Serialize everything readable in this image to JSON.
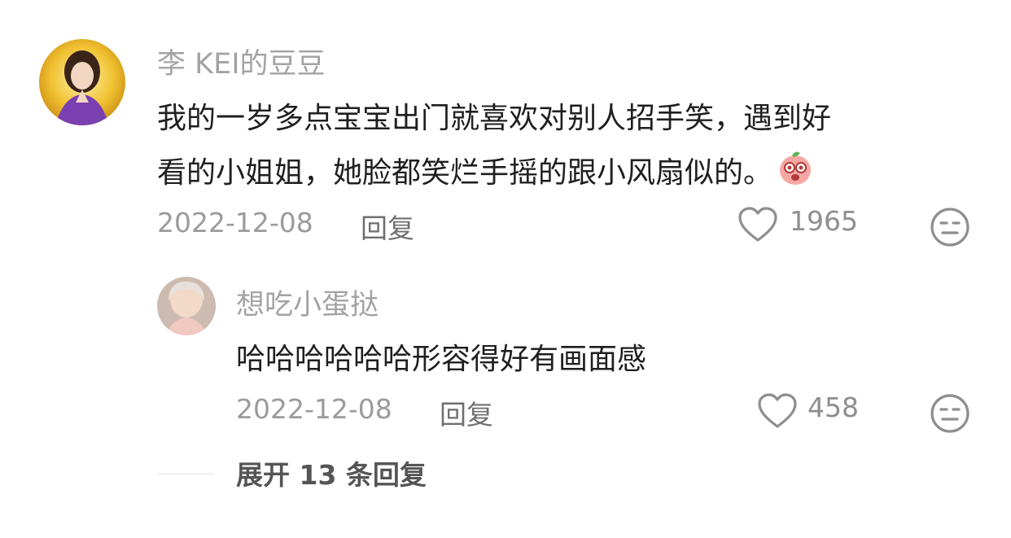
{
  "comment": {
    "username": "李 KEI的豆豆",
    "text_line1": "我的一岁多点宝宝出门就喜欢对别人招手笑，遇到好",
    "text_line2": "看的小姐姐，她脸都笑烂手摇的跟小风扇似的。",
    "emoji": "peach-face-emoji",
    "date": "2022-12-08",
    "reply_label": "回复",
    "like_count": "1965"
  },
  "reply": {
    "username": "想吃小蛋挞",
    "text": "哈哈哈哈哈哈形容得好有画面感",
    "date": "2022-12-08",
    "reply_label": "回复",
    "like_count": "458"
  },
  "expand": {
    "label": "展开 13 条回复"
  },
  "colors": {
    "username": "#a3a3a3",
    "text": "#1f1f1f",
    "meta": "#9b9b9b"
  }
}
